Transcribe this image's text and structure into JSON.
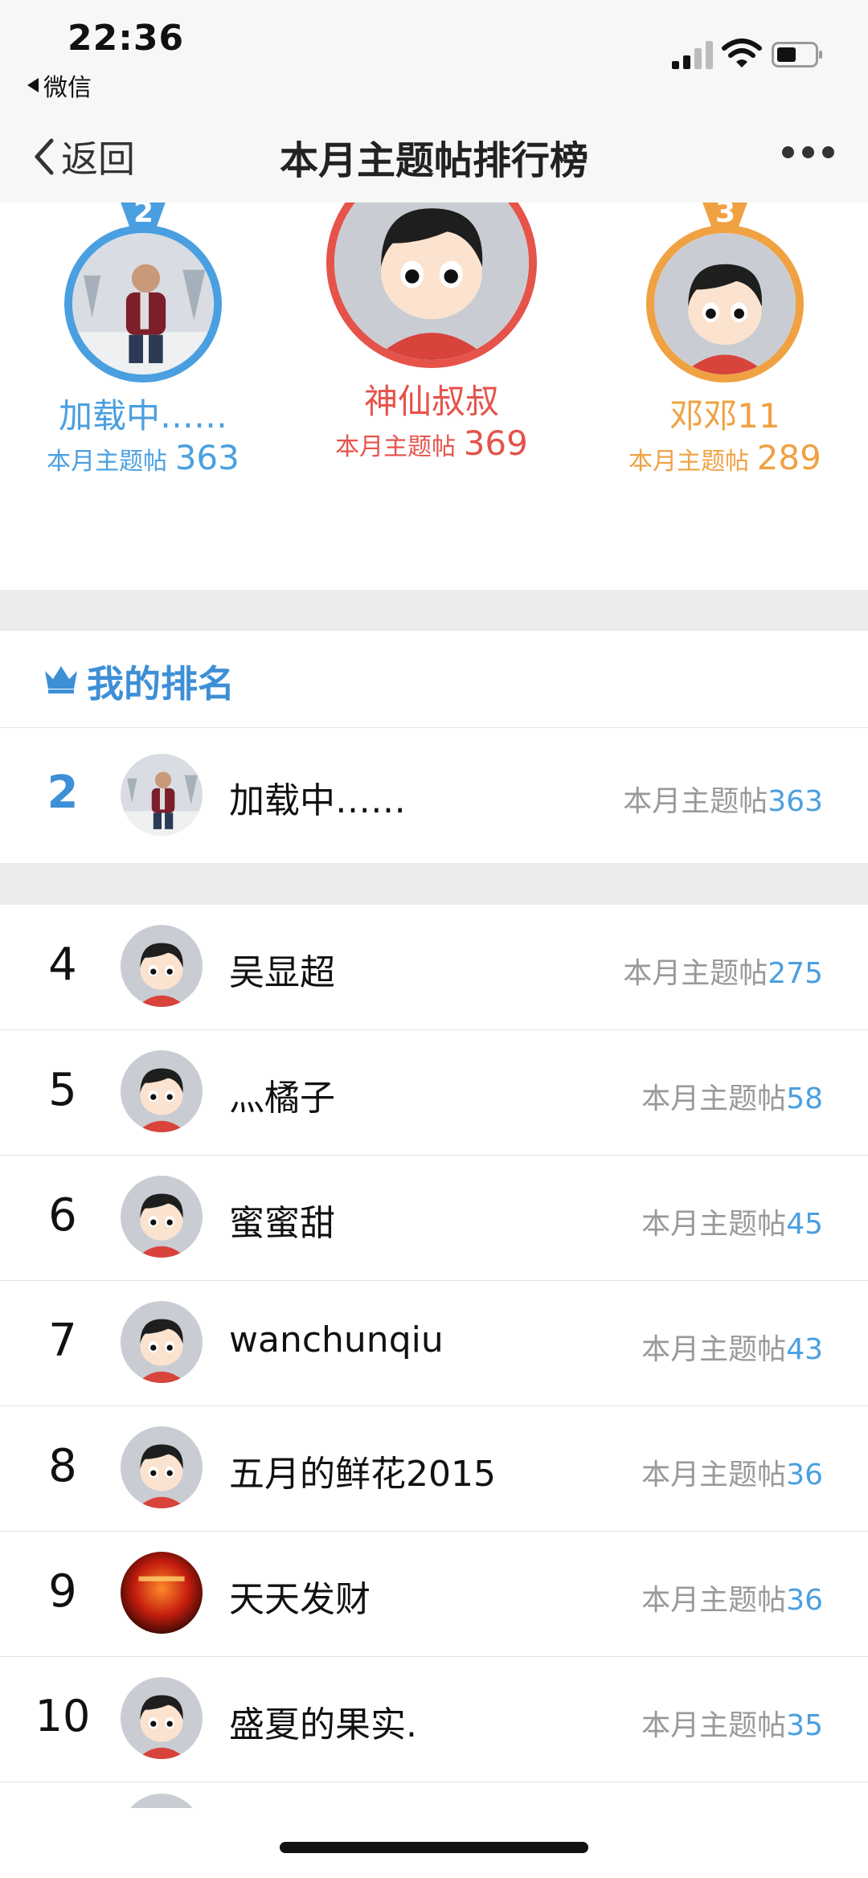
{
  "status_bar": {
    "time": "22:36",
    "back_app": "微信"
  },
  "nav": {
    "back_label": "返回",
    "title": "本月主题帖排行榜"
  },
  "podium": {
    "first": {
      "name": "神仙叔叔",
      "stat_label": "本月主题帖",
      "count": "369",
      "color": "#e5534b"
    },
    "second": {
      "name": "加载中……",
      "stat_label": "本月主题帖",
      "count": "363",
      "medal": "2",
      "color": "#4a9fe0"
    },
    "third": {
      "name": "邓邓11",
      "stat_label": "本月主题帖",
      "count": "289",
      "medal": "3",
      "color": "#f0a142"
    }
  },
  "my_rank": {
    "title": "我的排名",
    "rank": "2",
    "name": "加载中……",
    "stat_label": "本月主题帖",
    "count": "363"
  },
  "list": [
    {
      "rank": "4",
      "name": "吴显超",
      "stat_label": "本月主题帖",
      "count": "275",
      "avatar": "cartoon"
    },
    {
      "rank": "5",
      "name": "灬橘子",
      "stat_label": "本月主题帖",
      "count": "58",
      "avatar": "cartoon"
    },
    {
      "rank": "6",
      "name": "蜜蜜甜",
      "stat_label": "本月主题帖",
      "count": "45",
      "avatar": "cartoon"
    },
    {
      "rank": "7",
      "name": "wanchunqiu",
      "stat_label": "本月主题帖",
      "count": "43",
      "avatar": "cartoon"
    },
    {
      "rank": "8",
      "name": "五月的鲜花2015",
      "stat_label": "本月主题帖",
      "count": "36",
      "avatar": "cartoon"
    },
    {
      "rank": "9",
      "name": "天天发财",
      "stat_label": "本月主题帖",
      "count": "36",
      "avatar": "red-photo"
    },
    {
      "rank": "10",
      "name": "盛夏的果实.",
      "stat_label": "本月主题帖",
      "count": "35",
      "avatar": "cartoon"
    }
  ],
  "colors": {
    "accent_blue": "#3d8fd6",
    "count_blue": "#4a9fe0",
    "gold": "#f0a142",
    "red": "#e5534b"
  }
}
